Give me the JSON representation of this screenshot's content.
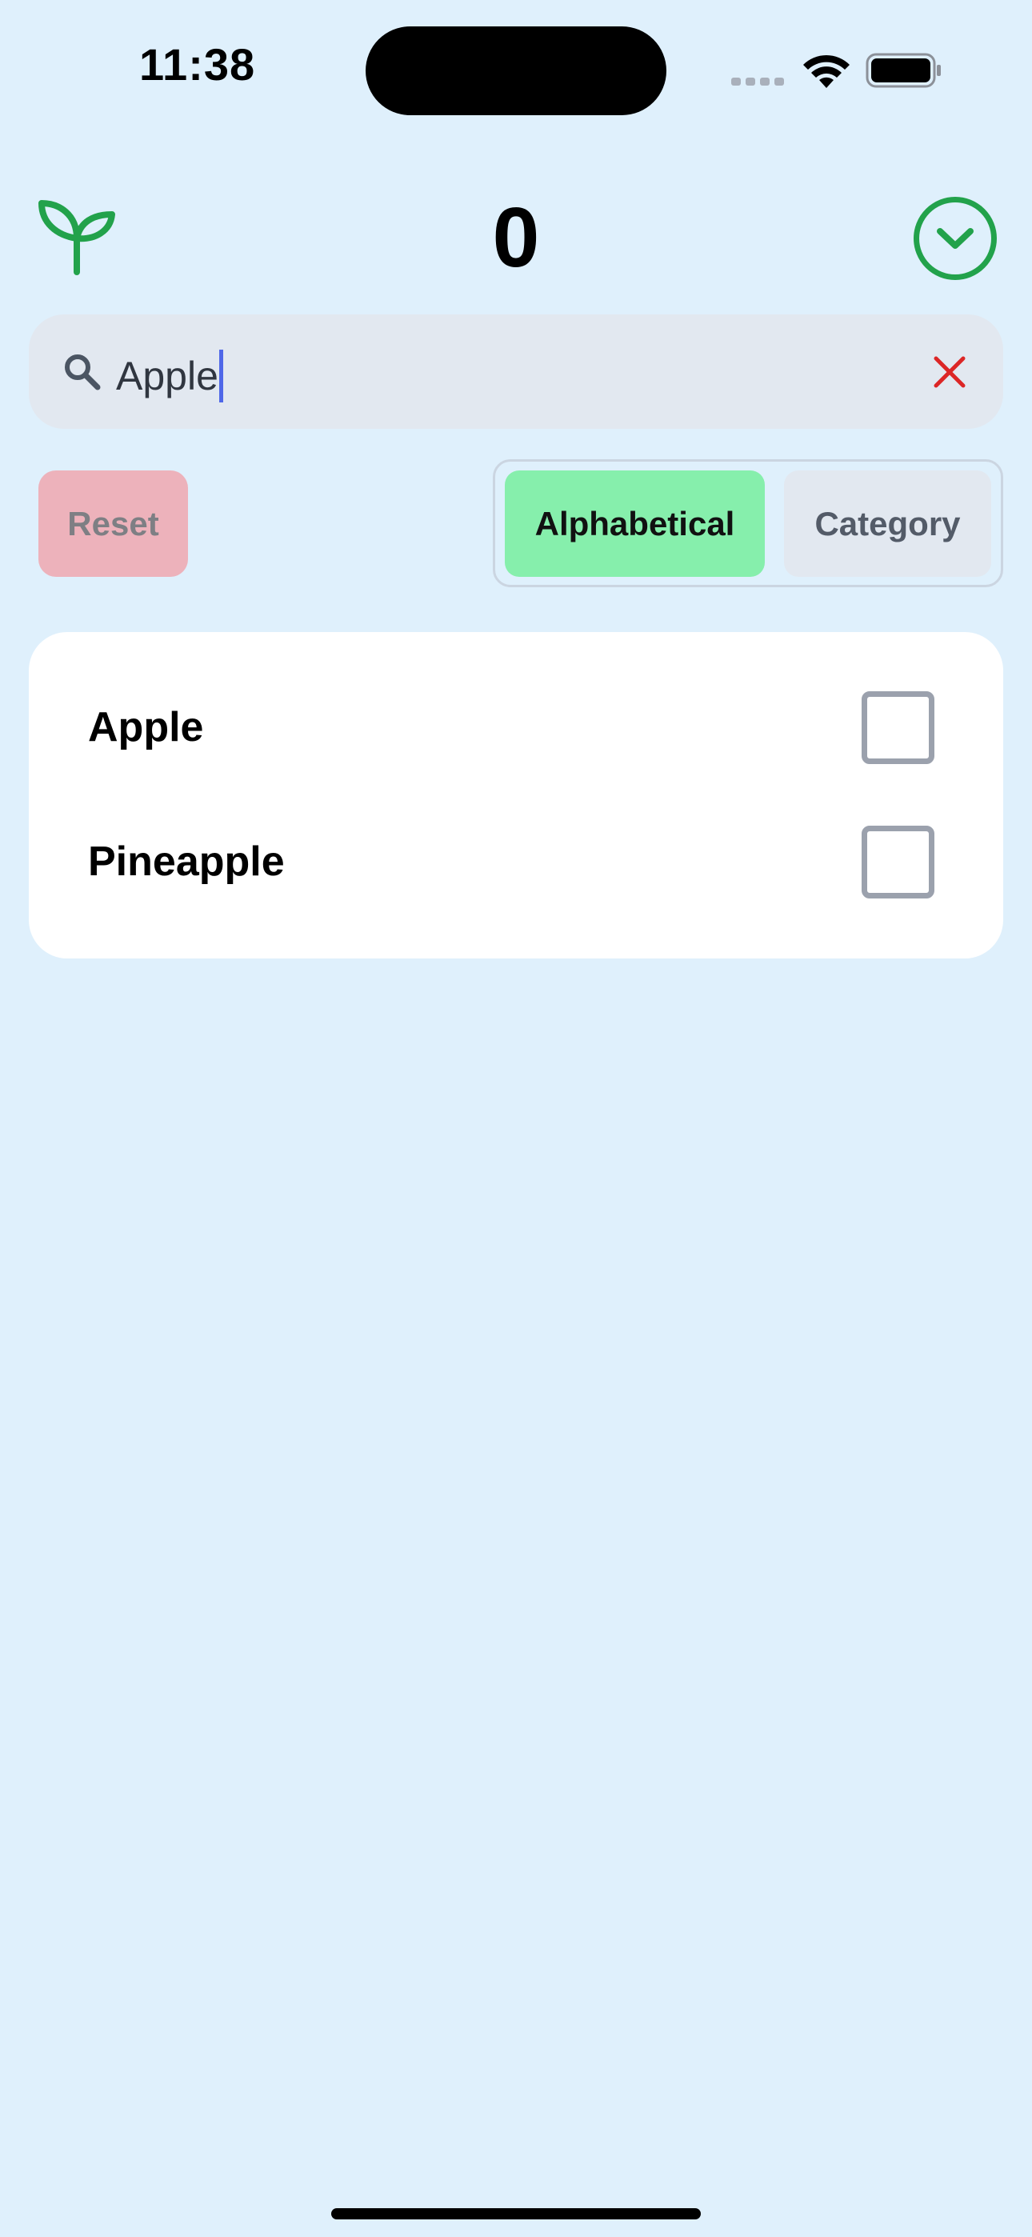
{
  "status_bar": {
    "time": "11:38"
  },
  "header": {
    "logo_icon": "sprout-icon",
    "count": "0",
    "collapse_icon": "chevron-down-circle-icon",
    "accent_color": "#22a24b"
  },
  "search": {
    "value": "Apple",
    "search_icon": "search-icon",
    "clear_icon": "close-icon",
    "clear_color": "#dc2626"
  },
  "controls": {
    "reset_label": "Reset",
    "sort_options": [
      {
        "label": "Alphabetical",
        "selected": true
      },
      {
        "label": "Category",
        "selected": false
      }
    ]
  },
  "list": {
    "items": [
      {
        "label": "Apple",
        "checked": false
      },
      {
        "label": "Pineapple",
        "checked": false
      }
    ]
  },
  "colors": {
    "background": "#dff0fc",
    "selected_sort": "#86efac",
    "reset": "#edb2bb"
  }
}
